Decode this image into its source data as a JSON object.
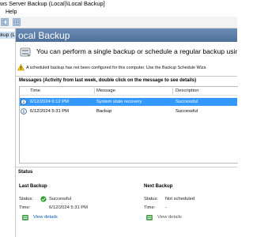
{
  "window": {
    "title": "ws Server Backup (Local)\\Local Backup]",
    "menu_help": "Help"
  },
  "tree": {
    "selected_item": "ckup (L"
  },
  "header": {
    "title": "ocal Backup"
  },
  "intro": {
    "text": "You can perform a single backup or schedule a regular backup using this"
  },
  "warning": {
    "text": "A scheduled backup has not been configured for this computer. Use the Backup Schedule Wiza"
  },
  "messages": {
    "title": "Messages (Activity from last week, double click on the message to see details)",
    "columns": {
      "time": "Time",
      "message": "Message",
      "description": "Description"
    },
    "rows": [
      {
        "time": "6/12/2024 6:12 PM",
        "message": "System state recovery",
        "description": "Successful",
        "selected": true
      },
      {
        "time": "6/12/2024 5:31 PM",
        "message": "Backup",
        "description": "Successful",
        "selected": false
      }
    ]
  },
  "status": {
    "title": "Status",
    "last_backup": {
      "title": "Last Backup",
      "status_label": "Status:",
      "status_value": "Successful",
      "time_label": "Time:",
      "time_value": "6/12/2024 5:31 PM",
      "details_link": "View details"
    },
    "next_backup": {
      "title": "Next Backup",
      "status_label": "Status:",
      "status_value": "Not scheduled",
      "time_label": "Time:",
      "time_value": "-",
      "details_link": "View details"
    }
  },
  "colors": {
    "header_blue": "#5a7ba6",
    "selection": "#3399ff",
    "success_green": "#2f9e2f",
    "link_blue": "#0b57a8"
  },
  "icons": [
    "backup-drive-icon",
    "warning-icon",
    "info-icon",
    "success-icon",
    "details-icon"
  ]
}
